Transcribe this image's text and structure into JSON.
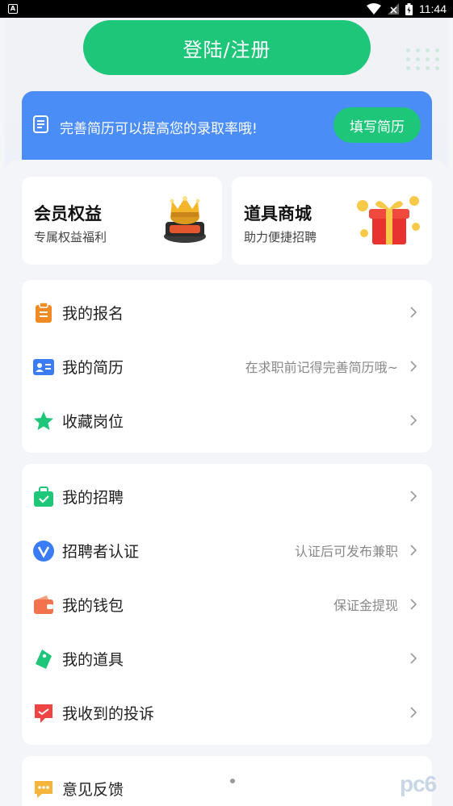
{
  "status_bar": {
    "notification_icon": "A",
    "time": "11:44"
  },
  "header": {
    "login_button": "登陆/注册"
  },
  "banner": {
    "text": "完善简历可以提高您的录取率哦!",
    "button": "填写简历",
    "icon": "document-icon"
  },
  "features": [
    {
      "title": "会员权益",
      "subtitle": "专属权益福利",
      "icon": "crown-icon"
    },
    {
      "title": "道具商城",
      "subtitle": "助力便捷招聘",
      "icon": "gift-box-icon"
    }
  ],
  "group1": [
    {
      "label": "我的报名",
      "hint": "",
      "icon": "clipboard-icon"
    },
    {
      "label": "我的简历",
      "hint": "在求职前记得完善简历哦~",
      "icon": "id-card-icon"
    },
    {
      "label": "收藏岗位",
      "hint": "",
      "icon": "star-icon"
    }
  ],
  "group2": [
    {
      "label": "我的招聘",
      "hint": "",
      "icon": "briefcase-icon"
    },
    {
      "label": "招聘者认证",
      "hint": "认证后可发布兼职",
      "icon": "verified-icon"
    },
    {
      "label": "我的钱包",
      "hint": "保证金提现",
      "icon": "wallet-icon"
    },
    {
      "label": "我的道具",
      "hint": "",
      "icon": "tag-icon"
    },
    {
      "label": "我收到的投诉",
      "hint": "",
      "icon": "complaint-icon"
    }
  ],
  "group3": [
    {
      "label": "意见反馈",
      "hint": "",
      "icon": "feedback-icon"
    }
  ],
  "watermark": "pc6",
  "colors": {
    "primary_green": "#1ec67a",
    "banner_blue": "#4a8df6"
  }
}
